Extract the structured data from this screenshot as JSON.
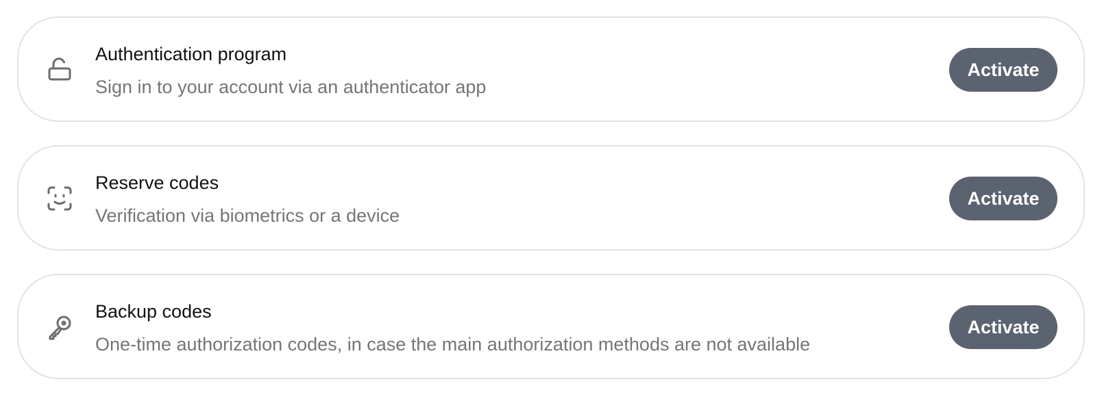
{
  "methods": [
    {
      "icon": "lock-open-icon",
      "title": "Authentication program",
      "description": "Sign in to your account via an authenticator app",
      "action_label": "Activate"
    },
    {
      "icon": "face-id-icon",
      "title": "Reserve codes",
      "description": "Verification via biometrics or a device",
      "action_label": "Activate"
    },
    {
      "icon": "key-icon",
      "title": "Backup codes",
      "description": "One-time authorization codes, in case the main authorization methods are not available",
      "action_label": "Activate"
    }
  ],
  "colors": {
    "button_background": "#5b6270",
    "card_border": "#e3e3e3",
    "description_text": "#757575",
    "icon_stroke": "#6b6b6b"
  }
}
